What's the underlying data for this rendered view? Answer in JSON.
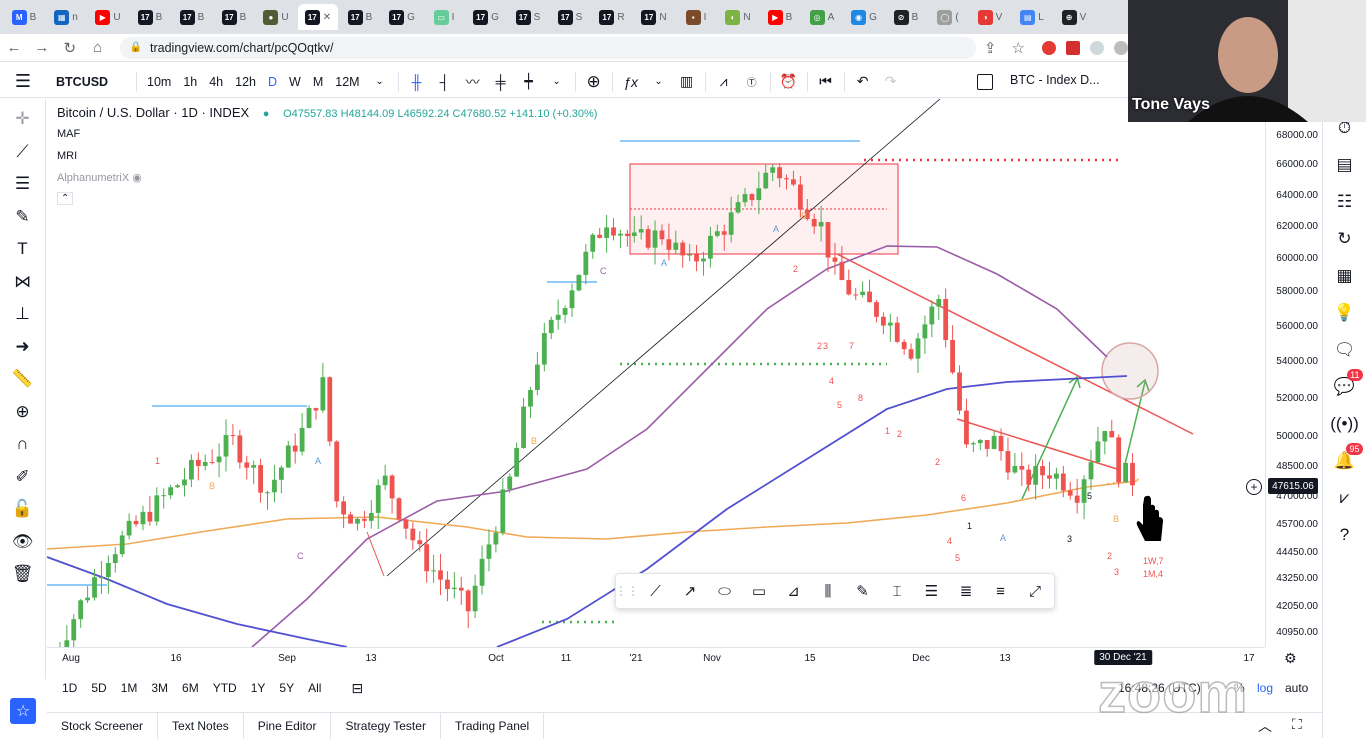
{
  "browser": {
    "tabs": [
      {
        "icon": "M",
        "label": "B",
        "color": "#2962ff"
      },
      {
        "icon": "▦",
        "label": "n",
        "color": "#1565c0"
      },
      {
        "icon": "▶",
        "label": "U",
        "color": "#ff0000"
      },
      {
        "icon": "17",
        "label": "B",
        "color": "#131722"
      },
      {
        "icon": "17",
        "label": "B",
        "color": "#131722"
      },
      {
        "icon": "17",
        "label": "B",
        "color": "#131722"
      },
      {
        "icon": "●",
        "label": "U",
        "color": "#4e5b35"
      },
      {
        "icon": "17",
        "label": "✕",
        "color": "#131722",
        "active": true
      },
      {
        "icon": "17",
        "label": "B",
        "color": "#131722"
      },
      {
        "icon": "17",
        "label": "G",
        "color": "#131722"
      },
      {
        "icon": "▭",
        "label": "I",
        "color": "#6c9"
      },
      {
        "icon": "17",
        "label": "G",
        "color": "#131722"
      },
      {
        "icon": "17",
        "label": "S",
        "color": "#131722"
      },
      {
        "icon": "17",
        "label": "S",
        "color": "#131722"
      },
      {
        "icon": "17",
        "label": "R",
        "color": "#131722"
      },
      {
        "icon": "17",
        "label": "N",
        "color": "#131722"
      },
      {
        "icon": "▪",
        "label": "I",
        "color": "#7a4b2a"
      },
      {
        "icon": "◐",
        "label": "N",
        "color": "#7cb342"
      },
      {
        "icon": "▶",
        "label": "B",
        "color": "#ff0000"
      },
      {
        "icon": "◎",
        "label": "A",
        "color": "#43a047"
      },
      {
        "icon": "◉",
        "label": "G",
        "color": "#1e88e5"
      },
      {
        "icon": "⊘",
        "label": "B",
        "color": "#202124"
      },
      {
        "icon": "◯",
        "label": "(",
        "color": "#9e9e9e"
      },
      {
        "icon": "◑",
        "label": "V",
        "color": "#e53935"
      },
      {
        "icon": "▤",
        "label": "L",
        "color": "#4285f4"
      },
      {
        "icon": "⊕",
        "label": "V",
        "color": "#202124"
      }
    ],
    "url": "tradingview.com/chart/pcQOqtkv/"
  },
  "toolbar": {
    "symbol": "BTCUSD",
    "timeframes": [
      "10m",
      "1h",
      "4h",
      "12h",
      "D",
      "W",
      "M",
      "12M"
    ],
    "selected_timeframe": "D",
    "layout_name": "BTC - Index D..."
  },
  "legend": {
    "title": "Bitcoin / U.S. Dollar · 1D · INDEX",
    "open": "O47557.83",
    "high": "H48144.09",
    "low": "L46592.24",
    "close": "C47680.52",
    "change": "+141.10 (+0.30%)",
    "indicators": [
      "MAF",
      "MRI",
      "AlphanumetriX"
    ]
  },
  "price_axis": {
    "labels": [
      "68000.00",
      "66000.00",
      "64000.00",
      "62000.00",
      "60000.00",
      "58000.00",
      "56000.00",
      "54000.00",
      "52000.00",
      "50000.00",
      "48500.00",
      "47000.00",
      "45700.00",
      "44450.00",
      "43250.00",
      "42050.00",
      "40950.00"
    ],
    "last_price": "47615.06"
  },
  "time_axis": {
    "labels": [
      "Aug",
      "16",
      "Sep",
      "13",
      "Oct",
      "11",
      "'21",
      "Nov",
      "15",
      "Dec",
      "13",
      "17"
    ],
    "current": "30 Dec '21"
  },
  "range_bar": {
    "ranges": [
      "1D",
      "5D",
      "1M",
      "3M",
      "6M",
      "YTD",
      "1Y",
      "5Y",
      "All"
    ],
    "clock": "16:48:26 (UTC)",
    "pct": "%",
    "log": "log",
    "auto": "auto"
  },
  "bottom_tabs": [
    "Stock Screener",
    "Text Notes",
    "Pine Editor",
    "Strategy Tester",
    "Trading Panel"
  ],
  "right_panel": {
    "badge_chat": "11",
    "badge_alerts": "95"
  },
  "webcam": {
    "name": "Tone Vays"
  },
  "watermark": "zoom",
  "chart_data": {
    "type": "candlestick",
    "symbol": "BTCUSD",
    "interval": "1D",
    "log_scale": true,
    "y_range": [
      40000,
      69500
    ],
    "last": 47680.52,
    "overlays": [
      "purple MA",
      "blue MA",
      "orange MA",
      "red trendline",
      "red box",
      "dotted levels"
    ],
    "annotations": {
      "count_labels_top": [
        "1W,7",
        "1M,4"
      ]
    }
  }
}
